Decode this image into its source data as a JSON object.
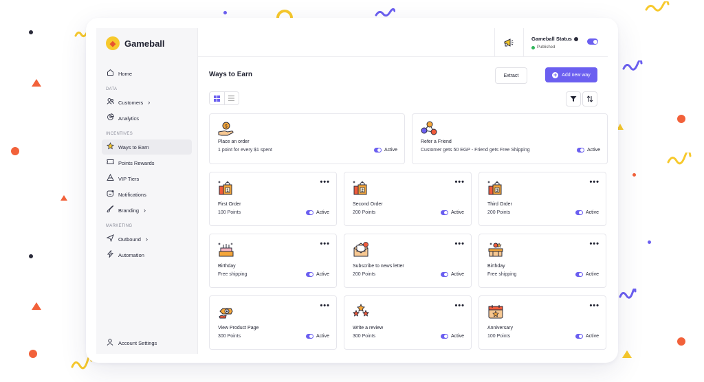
{
  "app": {
    "name": "Gameball"
  },
  "sidebar": {
    "items": [
      {
        "label": "Home",
        "icon": "home-icon"
      },
      {
        "section": "DATA"
      },
      {
        "label": "Customers",
        "icon": "users-icon",
        "chevron": true
      },
      {
        "label": "Analytics",
        "icon": "analytics-icon"
      },
      {
        "section": "INCENTIVES"
      },
      {
        "label": "Ways to Earn",
        "icon": "star-icon",
        "active": true
      },
      {
        "label": "Points Rewards",
        "icon": "ticket-icon"
      },
      {
        "label": "VIP Tiers",
        "icon": "tiers-icon"
      },
      {
        "label": "Notifications",
        "icon": "notification-icon"
      },
      {
        "label": "Branding",
        "icon": "brush-icon",
        "chevron": true
      },
      {
        "section": "MARKETING"
      },
      {
        "label": "Outbound",
        "icon": "send-icon",
        "chevron": true
      },
      {
        "label": "Automation",
        "icon": "bolt-icon"
      }
    ],
    "account_label": "Account Settings"
  },
  "header": {
    "status_title": "Gameball Status",
    "status_value": "Published"
  },
  "main": {
    "title": "Ways to Earn",
    "extract_label": "Extract",
    "add_label": "Add new way",
    "wide_cards": [
      {
        "title": "Place an order",
        "desc": "1 point for every $1 spent",
        "status": "Active",
        "icon": "coin-hand-icon"
      },
      {
        "title": "Refer a Friend",
        "desc": "Customer gets 50 EGP - Friend gets Free Shipping",
        "status": "Active",
        "icon": "referral-icon"
      }
    ],
    "cards": [
      {
        "title": "First Order",
        "desc": "100 Points",
        "status": "Active",
        "icon": "first-order-icon",
        "badge": "1"
      },
      {
        "title": "Second Order",
        "desc": "200 Points",
        "status": "Active",
        "icon": "second-order-icon",
        "badge": "2"
      },
      {
        "title": "Third Order",
        "desc": "200 Points",
        "status": "Active",
        "icon": "third-order-icon",
        "badge": "3"
      },
      {
        "title": "Birthday",
        "desc": "Free shipping",
        "status": "Active",
        "icon": "birthday-cake-icon"
      },
      {
        "title": "Subscribe to news letter",
        "desc": "200 Points",
        "status": "Active",
        "icon": "newsletter-icon"
      },
      {
        "title": "Birthday",
        "desc": "Free shipping",
        "status": "Active",
        "icon": "birthday-gift-icon"
      },
      {
        "title": "View Product Page",
        "desc": "300 Points",
        "status": "Active",
        "icon": "view-product-icon"
      },
      {
        "title": "Write a review",
        "desc": "300 Points",
        "status": "Active",
        "icon": "review-stars-icon"
      },
      {
        "title": "Anniversary",
        "desc": "100 Points",
        "status": "Active",
        "icon": "calendar-icon"
      }
    ]
  },
  "colors": {
    "accent": "#6b5ff0",
    "icon_orange": "#f4a63a",
    "icon_red": "#ef5b3b",
    "status_green": "#2fb65a"
  }
}
